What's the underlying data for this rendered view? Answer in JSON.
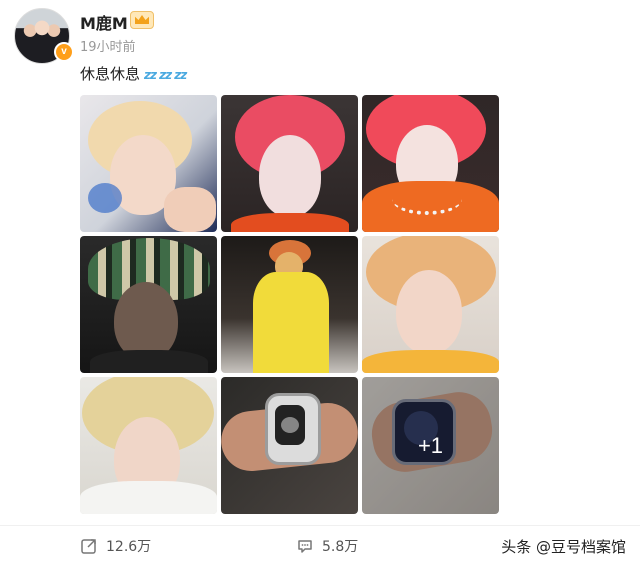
{
  "user": {
    "name": "M鹿M",
    "verified_mark": "v",
    "timestamp": "19小时前"
  },
  "post": {
    "text": "休息休息",
    "emoji": "zz zz zz",
    "more_count": "+1"
  },
  "photos": [
    {
      "id": "photo-1",
      "desc": "blonde hair closeup"
    },
    {
      "id": "photo-2",
      "desc": "red hair selfie"
    },
    {
      "id": "photo-3",
      "desc": "red hair with necklace"
    },
    {
      "id": "photo-4",
      "desc": "knit bucket hat"
    },
    {
      "id": "photo-5",
      "desc": "yellow shirt mirror selfie"
    },
    {
      "id": "photo-6",
      "desc": "blonde hair orange top"
    },
    {
      "id": "photo-7",
      "desc": "blonde hair white top"
    },
    {
      "id": "photo-8",
      "desc": "transparent watch on wrist"
    },
    {
      "id": "photo-9",
      "desc": "watch closeup"
    }
  ],
  "actions": {
    "repost_count": "12.6万",
    "comment_count": "5.8万"
  },
  "watermark": {
    "text": "头条 @豆号档案馆"
  },
  "colors": {
    "verified": "#ff9f1a",
    "zz_blue": "#4aa9e0"
  }
}
